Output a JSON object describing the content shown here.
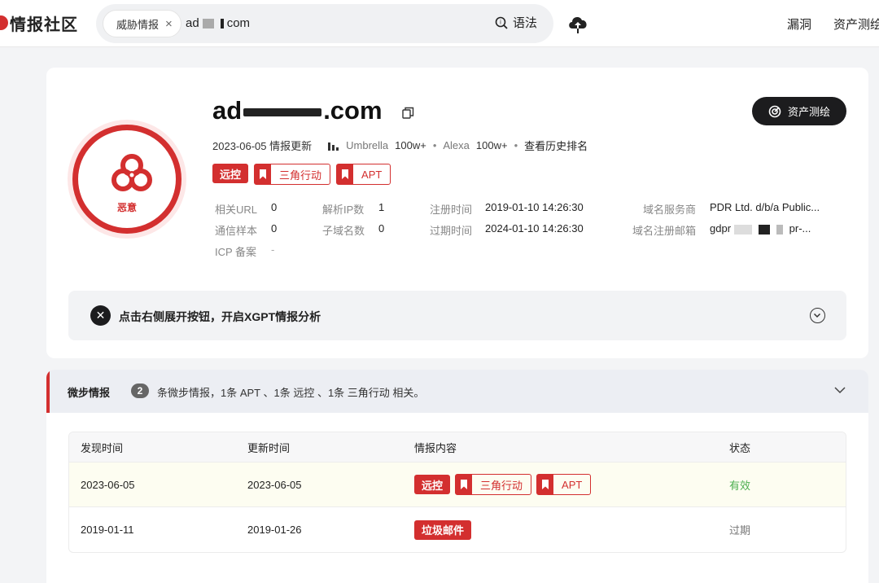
{
  "topbar": {
    "logo": "情报社区",
    "search": {
      "chip_label": "威胁情报",
      "chip_close": "×",
      "query_prefix": "ad",
      "query_suffix": "com"
    },
    "syntax_label": "语法",
    "nav": [
      "漏洞",
      "资产测绘"
    ]
  },
  "summary": {
    "verdict": "恶意",
    "domain_prefix": "ad",
    "domain_suffix": ".com",
    "asset_button": "资产测绘",
    "update": "2023-06-05 情报更新",
    "umbrella_label": "Umbrella",
    "umbrella_value": "100w+",
    "alexa_label": "Alexa",
    "alexa_value": "100w+",
    "history_link": "查看历史排名",
    "tags": [
      {
        "label": "远控",
        "style": "solid"
      },
      {
        "label": "三角行动",
        "style": "outline"
      },
      {
        "label": "APT",
        "style": "outline"
      }
    ],
    "fields": {
      "related_url": {
        "k": "相关URL",
        "v": "0"
      },
      "resolved_ip": {
        "k": "解析IP数",
        "v": "1"
      },
      "reg_time": {
        "k": "注册时间",
        "v": "2019-01-10 14:26:30"
      },
      "registrar": {
        "k": "域名服务商",
        "v": "PDR Ltd. d/b/a Public..."
      },
      "samples": {
        "k": "通信样本",
        "v": "0"
      },
      "subdomains": {
        "k": "子域名数",
        "v": "0"
      },
      "exp_time": {
        "k": "过期时间",
        "v": "2024-01-10 14:26:30"
      },
      "reg_email": {
        "k": "域名注册邮箱",
        "v_prefix": "gdpr",
        "v_suffix": "pr-..."
      },
      "icp": {
        "k": "ICP 备案",
        "v": "-"
      }
    },
    "xgpt_text": "点击右侧展开按钮，开启XGPT情报分析"
  },
  "micro": {
    "title": "微步情报",
    "count": "2",
    "desc": "条微步情报，1条 APT 、1条 远控 、1条 三角行动 相关。",
    "columns": [
      "发现时间",
      "更新时间",
      "情报内容",
      "状态"
    ],
    "rows": [
      {
        "found": "2023-06-05",
        "updated": "2023-06-05",
        "tags": [
          {
            "label": "远控",
            "style": "solid"
          },
          {
            "label": "三角行动",
            "style": "outline"
          },
          {
            "label": "APT",
            "style": "outline"
          }
        ],
        "status": "有效"
      },
      {
        "found": "2019-01-11",
        "updated": "2019-01-26",
        "tags": [
          {
            "label": "垃圾邮件",
            "style": "solid"
          }
        ],
        "status": "过期"
      }
    ]
  },
  "colors": {
    "accent_red": "#d32f2f",
    "status_valid": "#4caf50",
    "dark_button": "#1c1c1e"
  }
}
